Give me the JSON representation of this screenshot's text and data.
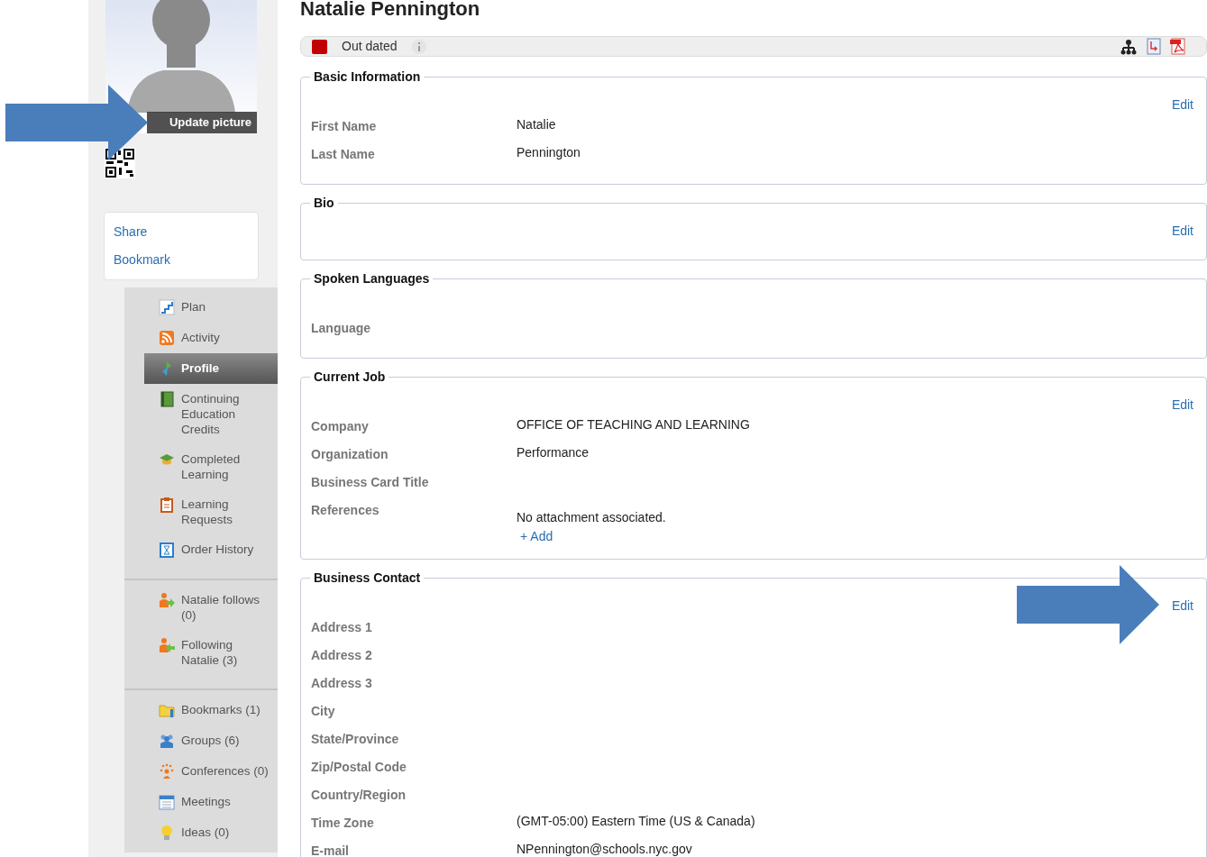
{
  "sidebar": {
    "photo_caption": "Update picture",
    "actions": [
      "Share",
      "Bookmark"
    ],
    "nav_groups": [
      [
        {
          "label": "Plan",
          "selected": false
        },
        {
          "label": "Activity",
          "selected": false
        },
        {
          "label": "Profile",
          "selected": true
        },
        {
          "label": "Continuing Education Credits",
          "selected": false
        },
        {
          "label": "Completed Learning",
          "selected": false
        },
        {
          "label": "Learning Requests",
          "selected": false
        },
        {
          "label": "Order History",
          "selected": false
        }
      ],
      [
        {
          "label": "Natalie follows (0)",
          "selected": false
        },
        {
          "label": "Following Natalie (3)",
          "selected": false
        }
      ],
      [
        {
          "label": "Bookmarks (1)",
          "selected": false
        },
        {
          "label": "Groups (6)",
          "selected": false
        },
        {
          "label": "Conferences (0)",
          "selected": false
        },
        {
          "label": "Meetings",
          "selected": false
        },
        {
          "label": "Ideas (0)",
          "selected": false
        }
      ]
    ]
  },
  "title": "Natalie Pennington",
  "status_bar": {
    "status": "Out dated",
    "color": "#c00000"
  },
  "sections": [
    {
      "legend": "Basic Information",
      "edit": "Edit",
      "fields": [
        {
          "label": "First Name",
          "value": "Natalie"
        },
        {
          "label": "Last Name",
          "value": "Pennington"
        }
      ]
    },
    {
      "legend": "Bio",
      "edit": "Edit"
    },
    {
      "legend": "Spoken Languages",
      "fields": [
        {
          "label": "Language"
        }
      ]
    },
    {
      "legend": "Current Job",
      "edit": "Edit",
      "fields": [
        {
          "label": "Company",
          "value": "OFFICE OF TEACHING AND LEARNING"
        },
        {
          "label": "Organization",
          "value": "Performance"
        },
        {
          "label": "Business Card Title"
        },
        {
          "label": "References",
          "value": "No attachment associated.",
          "link": "+ Add"
        }
      ]
    },
    {
      "legend": "Business Contact",
      "edit": "Edit",
      "fields": [
        {
          "label": "Address 1"
        },
        {
          "label": "Address 2"
        },
        {
          "label": "Address 3"
        },
        {
          "label": "City"
        },
        {
          "label": "State/Province"
        },
        {
          "label": "Zip/Postal Code"
        },
        {
          "label": "Country/Region"
        },
        {
          "label": "Time Zone",
          "value": "(GMT-05:00) Eastern Time (US & Canada)"
        },
        {
          "label": "E-mail",
          "value": "NPennington@schools.nyc.gov"
        }
      ]
    }
  ]
}
